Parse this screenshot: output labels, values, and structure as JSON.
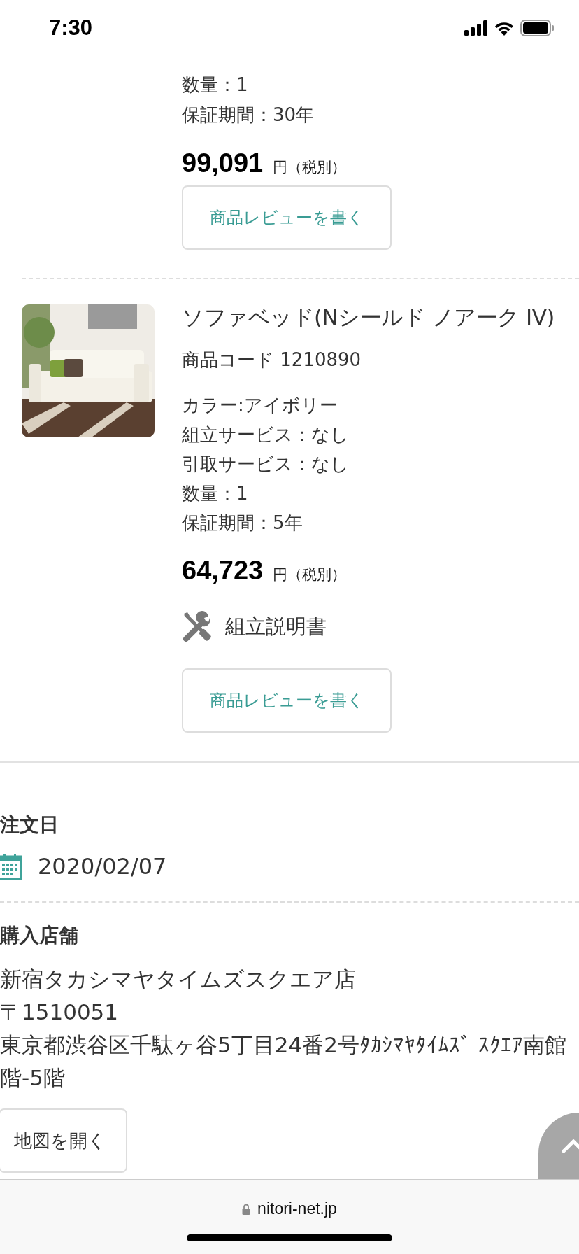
{
  "status_bar": {
    "time": "7:30"
  },
  "products": [
    {
      "attributes": [
        "数量：1",
        "保証期間：30年"
      ],
      "price": "99,091",
      "price_suffix": "円（税別）",
      "review_button": "商品レビューを書く"
    },
    {
      "title": "ソファベッド(Nシールド ノアーク IV)",
      "code": "商品コード 1210890",
      "attributes": [
        "カラー:アイボリー",
        "組立サービス：なし",
        "引取サービス：なし",
        "数量：1",
        "保証期間：5年"
      ],
      "price": "64,723",
      "price_suffix": "円（税別）",
      "manual_link": "組立説明書",
      "review_button": "商品レビューを書く"
    }
  ],
  "order_date": {
    "heading": "注文日",
    "date": "2020/02/07"
  },
  "store": {
    "heading": "購入店舗",
    "lines": [
      "新宿タカシマヤタイムズスクエア店",
      "〒1510051",
      "東京都渋谷区千駄ヶ谷5丁目24番2号ﾀｶｼﾏﾔﾀｲﾑｽﾞ ｽｸｴｱ南館",
      "階-5階"
    ],
    "map_button": "地図を開く"
  },
  "browser_bar": {
    "url": "nitori-net.jp"
  }
}
